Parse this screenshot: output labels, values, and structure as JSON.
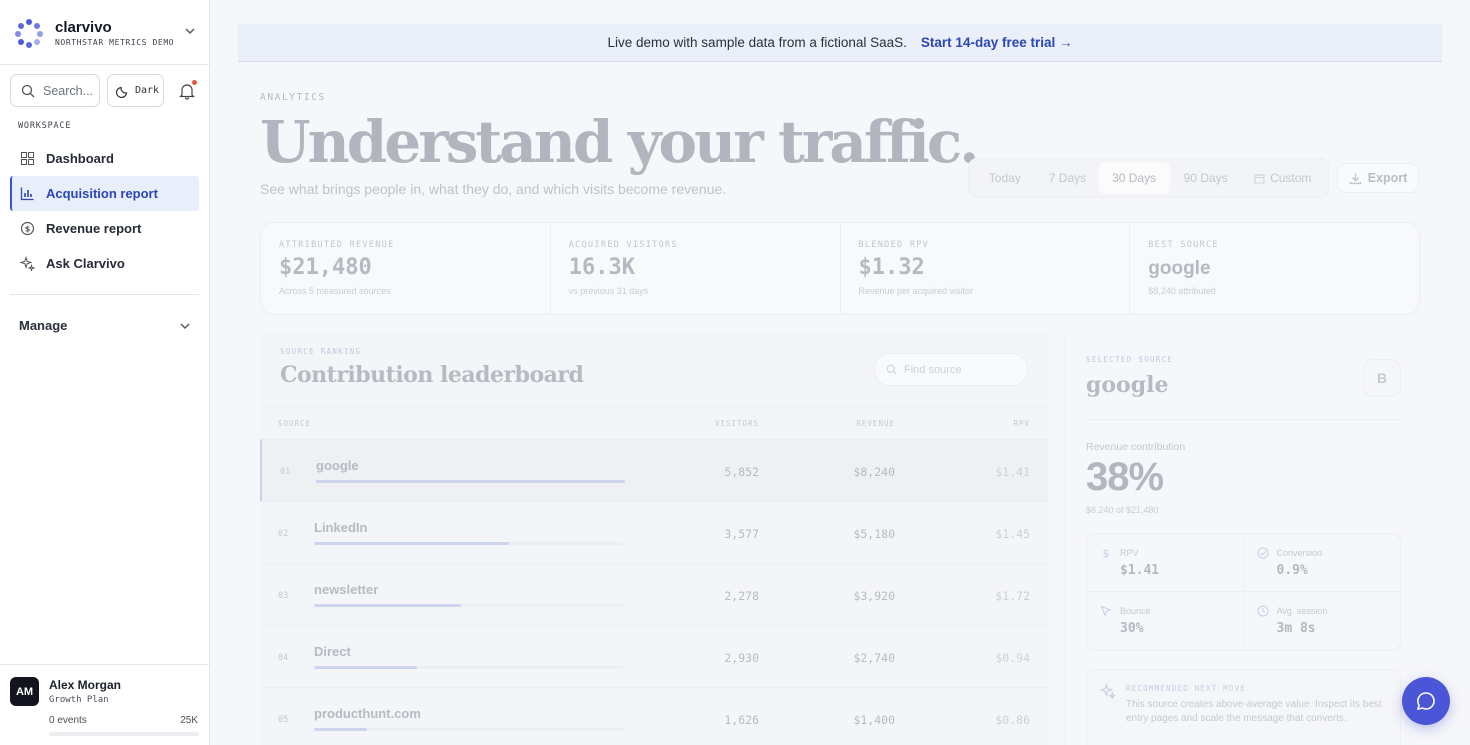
{
  "brand": {
    "name": "clarvivo",
    "subtitle": "NORTHSTAR METRICS DEMO"
  },
  "sidebar": {
    "search_label": "Search...",
    "theme_label": "Dark",
    "section_label": "WORKSPACE",
    "items": [
      {
        "label": "Dashboard",
        "icon": "grid-icon"
      },
      {
        "label": "Acquisition report",
        "icon": "bar-chart-icon",
        "active": true
      },
      {
        "label": "Revenue report",
        "icon": "dollar-circle-icon"
      },
      {
        "label": "Ask Clarvivo",
        "icon": "sparkle-icon"
      }
    ],
    "manage_label": "Manage"
  },
  "user": {
    "initials": "AM",
    "name": "Alex Morgan",
    "plan": "Growth Plan",
    "events": "0 events",
    "limit": "25K",
    "usage_fraction": 0.0
  },
  "banner": {
    "text": "Live demo with sample data from a fictional SaaS.",
    "cta": "Start 14-day free trial →"
  },
  "page": {
    "eyebrow": "ANALYTICS",
    "title": "Understand your traffic.",
    "subtitle": "See what brings people in, what they do, and which visits become revenue."
  },
  "range": {
    "options": [
      "Today",
      "7 Days",
      "30 Days",
      "90 Days",
      "Custom"
    ],
    "selected": "30 Days"
  },
  "export_label": "Export",
  "kpis": [
    {
      "label": "ATTRIBUTED REVENUE",
      "value": "$21,480",
      "note": "Across 5 measured sources"
    },
    {
      "label": "ACQUIRED VISITORS",
      "value": "16.3K",
      "note": "vs previous 31 days"
    },
    {
      "label": "BLENDED RPV",
      "value": "$1.32",
      "note": "Revenue per acquired visitor"
    },
    {
      "label": "BEST SOURCE",
      "value": "google",
      "note": "$8,240 attributed"
    }
  ],
  "leaderboard": {
    "eyebrow": "SOURCE RANKING",
    "title": "Contribution leaderboard",
    "find_placeholder": "Find source",
    "columns": [
      "SOURCE",
      "VISITORS",
      "REVENUE",
      "RPV"
    ],
    "rows": [
      {
        "rank": "01",
        "name": "google",
        "visitors": "5,852",
        "revenue": "$8,240",
        "rpv": "$1.41",
        "share": 1.0,
        "selected": true
      },
      {
        "rank": "02",
        "name": "LinkedIn",
        "visitors": "3,577",
        "revenue": "$5,180",
        "rpv": "$1.45",
        "share": 0.63
      },
      {
        "rank": "03",
        "name": "newsletter",
        "visitors": "2,278",
        "revenue": "$3,920",
        "rpv": "$1.72",
        "share": 0.476
      },
      {
        "rank": "04",
        "name": "Direct",
        "visitors": "2,930",
        "revenue": "$2,740",
        "rpv": "$0.94",
        "share": 0.333
      },
      {
        "rank": "05",
        "name": "producthunt.com",
        "visitors": "1,626",
        "revenue": "$1,400",
        "rpv": "$0.86",
        "share": 0.17
      }
    ]
  },
  "detail": {
    "eyebrow": "SELECTED SOURCE",
    "title": "google",
    "badge": "B",
    "contribution_label": "Revenue contribution",
    "contribution_value": "38%",
    "contribution_note": "$8,240 of $21,480",
    "metrics": [
      {
        "label": "RPV",
        "value": "$1.41",
        "icon": "dollar-icon"
      },
      {
        "label": "Conversion",
        "value": "0.9%",
        "icon": "check-circle-icon"
      },
      {
        "label": "Bounce",
        "value": "30%",
        "icon": "cursor-icon"
      },
      {
        "label": "Avg. session",
        "value": "3m 8s",
        "icon": "clock-icon"
      }
    ],
    "reco_label": "RECOMMENDED NEXT MOVE",
    "reco_text": "This source creates above-average value. Inspect its best entry pages and scale the message that converts."
  },
  "colors": {
    "accent": "#3b56d0",
    "fab": "#4a55d8"
  }
}
